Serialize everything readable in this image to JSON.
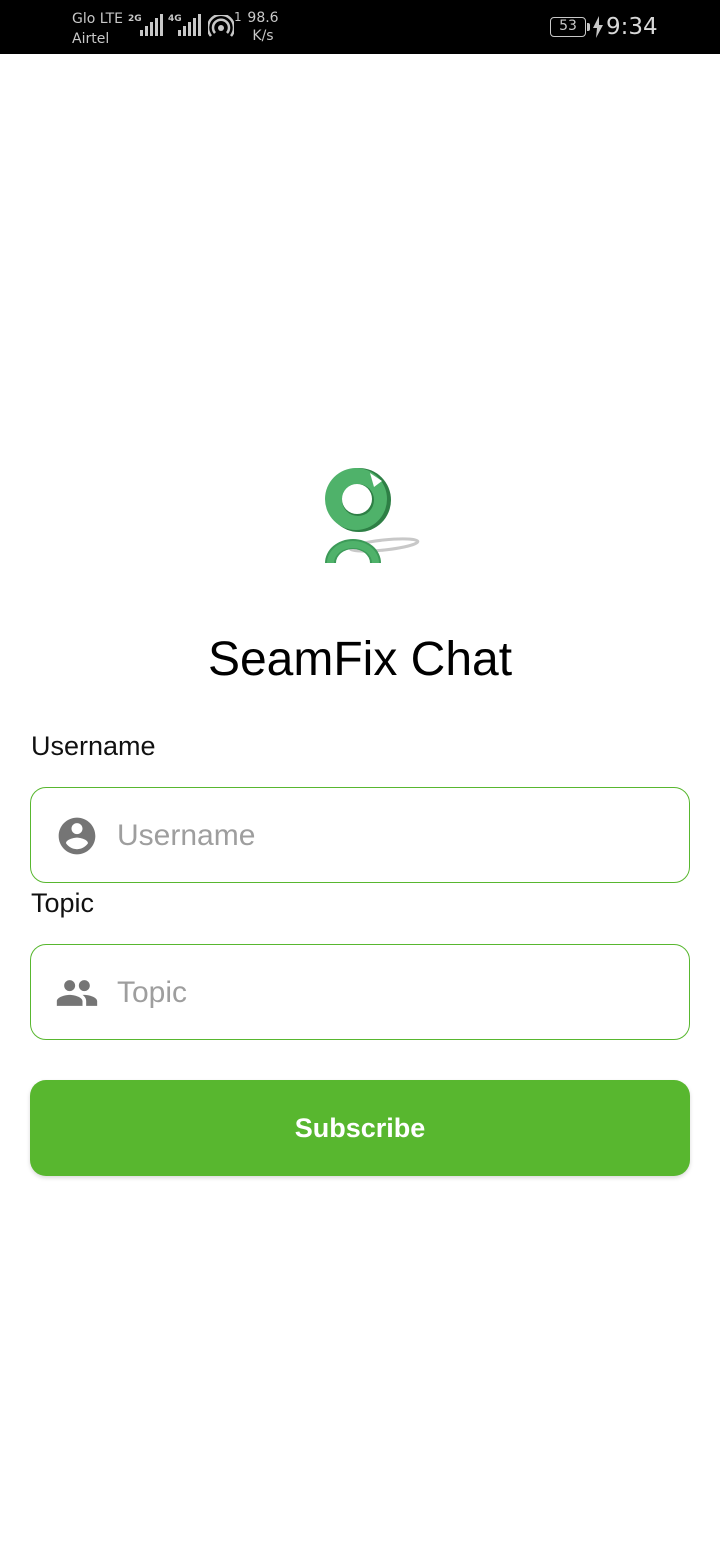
{
  "status_bar": {
    "carrier_1": "Glo LTE",
    "carrier_2": "Airtel",
    "network_tag_1": "2G",
    "network_tag_2": "4G",
    "hotspot_count": "1",
    "speed_value": "98.6",
    "speed_unit": "K/s",
    "battery": "53",
    "time": "9:34"
  },
  "app": {
    "title": "SeamFix Chat",
    "accent_color": "#58b72f"
  },
  "form": {
    "username": {
      "label": "Username",
      "placeholder": "Username",
      "value": "",
      "icon": "account-circle-icon"
    },
    "topic": {
      "label": "Topic",
      "placeholder": "Topic",
      "value": "",
      "icon": "people-icon"
    },
    "subscribe_label": "Subscribe"
  }
}
